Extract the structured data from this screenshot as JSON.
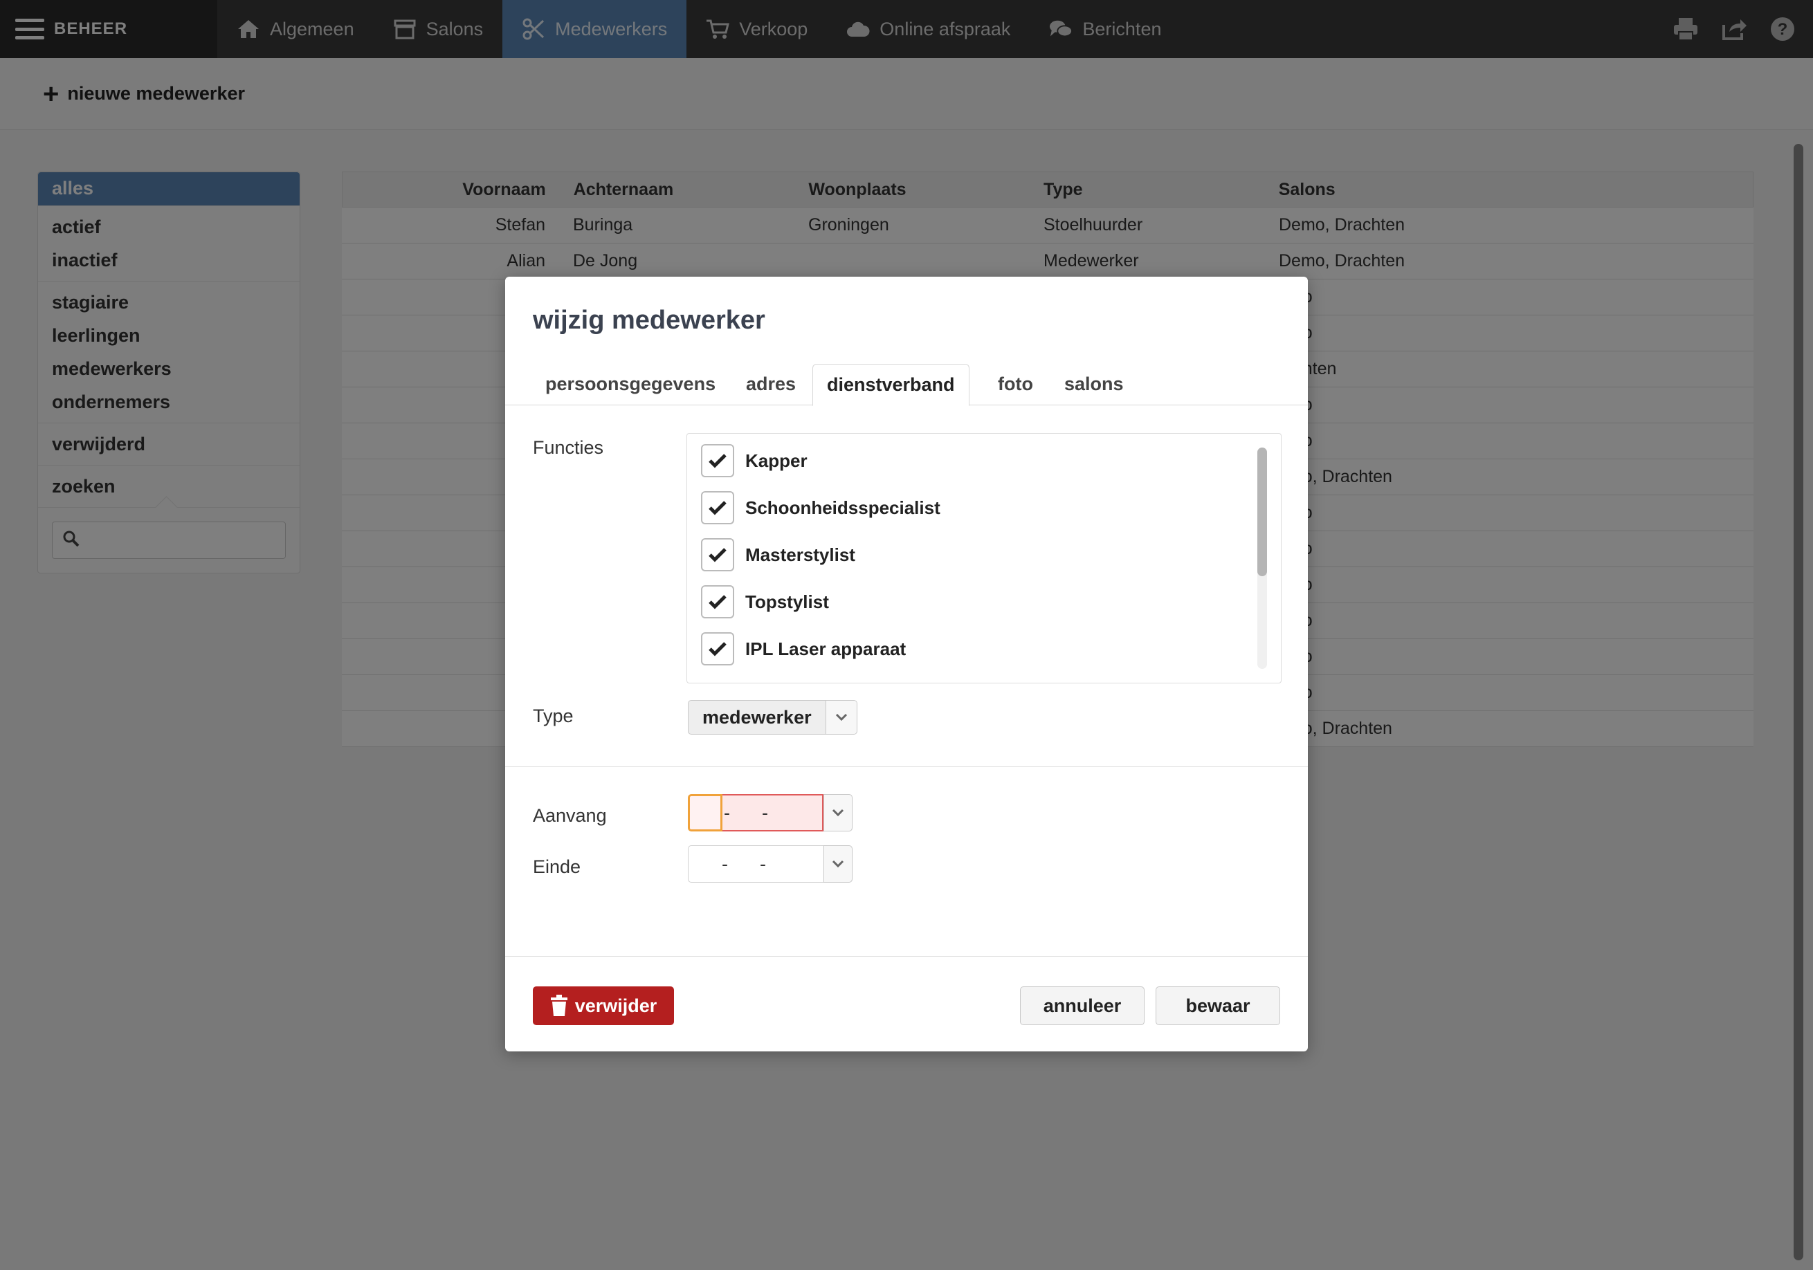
{
  "topbar": {
    "brand": "BEHEER",
    "nav": [
      {
        "label": "Algemeen",
        "icon": "home-icon"
      },
      {
        "label": "Salons",
        "icon": "store-icon"
      },
      {
        "label": "Medewerkers",
        "icon": "scissors-icon",
        "active": true
      },
      {
        "label": "Verkoop",
        "icon": "cart-icon"
      },
      {
        "label": "Online afspraak",
        "icon": "cloud-icon"
      },
      {
        "label": "Berichten",
        "icon": "chat-icon"
      }
    ],
    "right_icons": [
      "print-icon",
      "share-icon",
      "help-icon"
    ]
  },
  "subheader": {
    "new_label": "nieuwe medewerker"
  },
  "sidebar": {
    "active": "alles",
    "groups": [
      [
        "actief",
        "inactief"
      ],
      [
        "stagiaire",
        "leerlingen",
        "medewerkers",
        "ondernemers"
      ],
      [
        "verwijderd"
      ],
      [
        "zoeken"
      ]
    ]
  },
  "table": {
    "headers": [
      "Voornaam",
      "Achternaam",
      "Woonplaats",
      "Type",
      "Salons"
    ],
    "rows": [
      [
        "Stefan",
        "Buringa",
        "Groningen",
        "Stoelhuurder",
        "Demo, Drachten"
      ],
      [
        "Alian",
        "De Jong",
        "",
        "Medewerker",
        "Demo, Drachten"
      ],
      [
        "",
        "",
        "",
        "",
        "emo"
      ],
      [
        "",
        "",
        "",
        "",
        "emo"
      ],
      [
        "",
        "",
        "",
        "",
        "rachten"
      ],
      [
        "",
        "",
        "",
        "",
        "emo"
      ],
      [
        "",
        "",
        "",
        "",
        "emo"
      ],
      [
        "",
        "",
        "",
        "",
        "emo, Drachten"
      ],
      [
        "",
        "",
        "",
        "",
        "emo"
      ],
      [
        "",
        "",
        "",
        "",
        "emo"
      ],
      [
        "",
        "",
        "",
        "",
        "emo"
      ],
      [
        "",
        "",
        "",
        "",
        "emo"
      ],
      [
        "",
        "",
        "",
        "",
        "emo"
      ],
      [
        "",
        "",
        "",
        "",
        "emo"
      ],
      [
        "",
        "",
        "",
        "",
        "emo, Drachten"
      ]
    ]
  },
  "modal": {
    "title": "wijzig medewerker",
    "tabs": [
      "persoonsgegevens",
      "adres",
      "dienstverband",
      "foto",
      "salons"
    ],
    "active_tab": "dienstverband",
    "functies_label": "Functies",
    "functies": [
      "Kapper",
      "Schoonheidsspecialist",
      "Masterstylist",
      "Topstylist",
      "IPL Laser apparaat"
    ],
    "type_label": "Type",
    "type_value": "medewerker",
    "aanvang_label": "Aanvang",
    "einde_label": "Einde",
    "date_sep": "-",
    "delete_label": "verwijder",
    "cancel_label": "annuleer",
    "save_label": "bewaar"
  },
  "colors": {
    "accent": "#5a87b7",
    "danger": "#b41f1f",
    "topbar": "#3a3a3a"
  }
}
